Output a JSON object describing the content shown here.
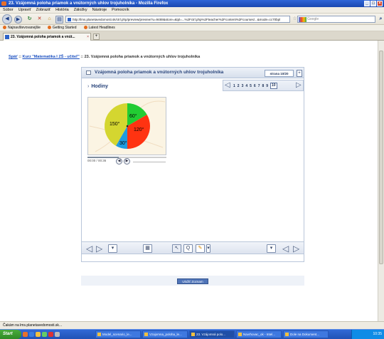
{
  "window": {
    "title": "23. Vzájomná poloha priamok a vnútorných uhlov trojuholníka - Mozilla Firefox"
  },
  "menu": [
    "Súbor",
    "Upraviť",
    "Zobraziť",
    "História",
    "Záložky",
    "Nástroje",
    "Pomocník"
  ],
  "nav": {
    "url": "http://lms.planetavedomosti.sk/ctrl.php/preview/preview?u=9488&store=&tpl=...%2Fctrl.php%2Fteacher%2Fcontent%2Fcourses/...&mode=cc70bpl",
    "search_placeholder": "Google"
  },
  "bookmarks": [
    "Najnavštevovanejšie",
    "Getting Started",
    "Latest Headlines"
  ],
  "tab": {
    "label": "23. Vzájomná poloha priamok a vnút..."
  },
  "breadcrumb": {
    "back": "Späť",
    "sep1": " :: ",
    "course": "Kurz \"Matematika I ZŠ - učiteľ\"",
    "sep2": " :: ",
    "current": "23. Vzájomná poloha priamok a vnútorných uhlov trojuholníka"
  },
  "lesson": {
    "title": "Vzájomná poloha priamok a vnútorných uhlov trojuholníka",
    "page_indicator": "strana 10/20",
    "plus": "+",
    "section": "Hodiny",
    "pages": [
      "1",
      "2",
      "3",
      "4",
      "5",
      "6",
      "7",
      "8",
      "9"
    ],
    "current_page": "10"
  },
  "clock": {
    "segments": [
      {
        "label": "60°",
        "color": "#22cc33"
      },
      {
        "label": "120°",
        "color": "#ff3311"
      },
      {
        "label": "30°",
        "color": "#1e9be0"
      },
      {
        "label": "150°",
        "color": "#d4d630"
      }
    ]
  },
  "player": {
    "time": "00:00 / 00:36",
    "progress": 0.4
  },
  "save_button": "Uložiť Zoznam",
  "status": "Čakám na lms.planetavedomosti.sk...",
  "taskbar": {
    "start": "Start",
    "tasks": [
      "Model_scenario_le...",
      "Vzajomna_poloha_le...",
      "23. Vzájomná polo...",
      "Navrhovac_ok - Intel...",
      "Dole na Dokument..."
    ],
    "clock": "10:35"
  }
}
